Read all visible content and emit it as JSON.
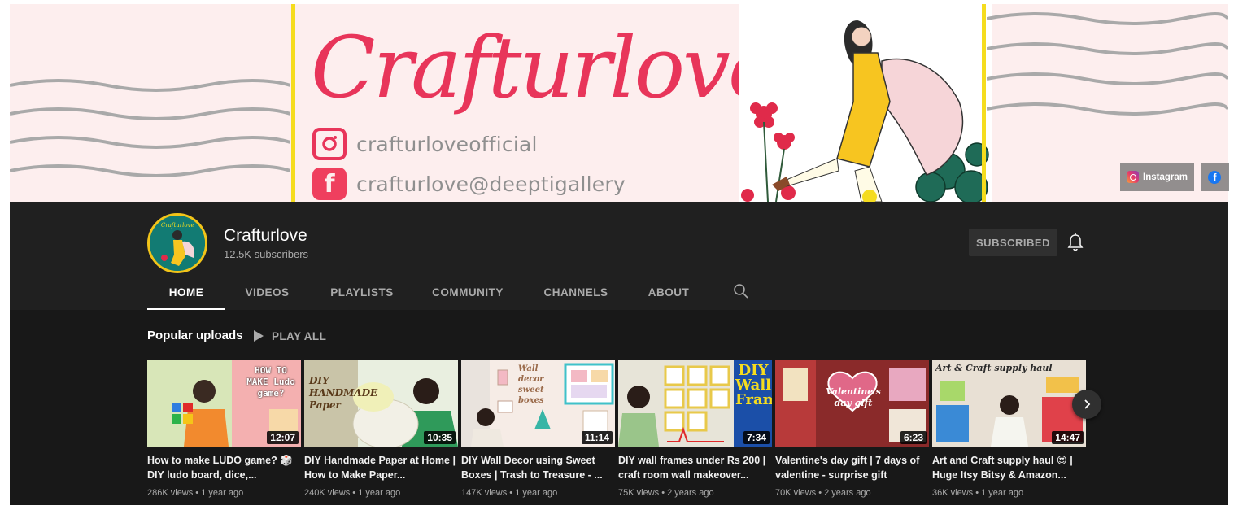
{
  "banner": {
    "logo_text": "Crafturlove",
    "instagram_handle": "crafturloveofficial",
    "facebook_handle": "crafturlove@deeptigallery",
    "links": {
      "instagram_label": "Instagram"
    }
  },
  "channel": {
    "name": "Crafturlove",
    "subscribers": "12.5K subscribers",
    "subscribe_label": "SUBSCRIBED"
  },
  "tabs": [
    {
      "label": "HOME",
      "active": true
    },
    {
      "label": "VIDEOS",
      "active": false
    },
    {
      "label": "PLAYLISTS",
      "active": false
    },
    {
      "label": "COMMUNITY",
      "active": false
    },
    {
      "label": "CHANNELS",
      "active": false
    },
    {
      "label": "ABOUT",
      "active": false
    }
  ],
  "section": {
    "title": "Popular uploads",
    "play_all": "PLAY ALL"
  },
  "videos": [
    {
      "title": "How to make LUDO game? 🎲 DIY ludo board, dice,...",
      "duration": "12:07",
      "meta": "286K views • 1 year ago",
      "thumb_text": "HOW TO MAKE Ludo game?"
    },
    {
      "title": "DIY Handmade Paper at Home | How to Make Paper...",
      "duration": "10:35",
      "meta": "240K views • 1 year ago",
      "thumb_text": "DIY HANDMADE Paper"
    },
    {
      "title": "DIY Wall Decor using Sweet Boxes | Trash to Treasure - ...",
      "duration": "11:14",
      "meta": "147K views • 1 year ago",
      "thumb_text": "Wall decor sweet boxes"
    },
    {
      "title": "DIY wall frames under Rs 200 | craft room wall makeover...",
      "duration": "7:34",
      "meta": "75K views • 2 years ago",
      "thumb_text": "DIY Wall Frames"
    },
    {
      "title": "Valentine's day gift | 7 days of valentine - surprise gift",
      "duration": "6:23",
      "meta": "70K views • 2 years ago",
      "thumb_text": "Valentine's day gift"
    },
    {
      "title": "Art and Craft supply haul 😍 | Huge Itsy Bitsy & Amazon...",
      "duration": "14:47",
      "meta": "36K views • 1 year ago",
      "thumb_text": "Art & Craft supply haul"
    }
  ],
  "colors": {
    "banner_bg": "#fdeeee",
    "logo_pink": "#e8355a",
    "accent_yellow": "#f5dc1e",
    "header_bg": "#202020",
    "content_bg": "#181818"
  }
}
